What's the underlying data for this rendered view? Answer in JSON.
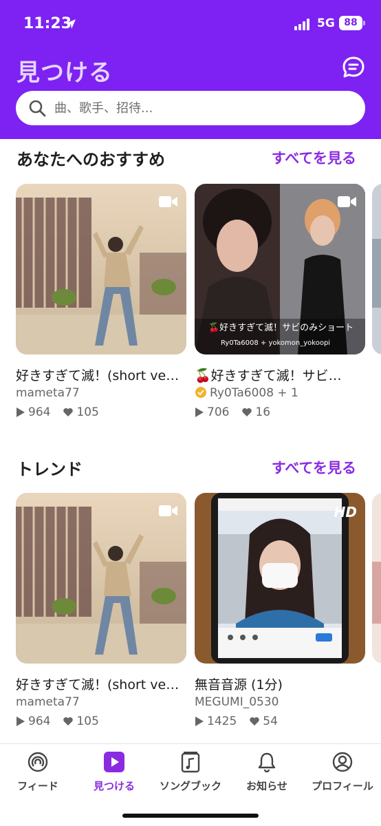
{
  "status": {
    "time": "11:23",
    "network": "5G",
    "battery": "88"
  },
  "header": {
    "title": "見つける"
  },
  "search": {
    "placeholder": "曲、歌手、招待..."
  },
  "sections": [
    {
      "title": "あなたへのおすすめ",
      "see_all": "すべてを見る",
      "cards": [
        {
          "title": "好きすぎて滅！(short ve…",
          "user": "mameta77",
          "plays": "964",
          "likes": "105",
          "badge": "video-icon"
        },
        {
          "title": "🍒好きすぎて滅！サビ…",
          "user": "Ry0Ta6008 + 1",
          "plays": "706",
          "likes": "16",
          "badge": "video-icon",
          "verified": true,
          "overlay_caption": "🍒好きすぎて滅！サビのみショート",
          "overlay_sub": "Ry0Ta6008 + yokomon_yokoopi"
        }
      ]
    },
    {
      "title": "トレンド",
      "see_all": "すべてを見る",
      "cards": [
        {
          "title": "好きすぎて滅！(short ve…",
          "user": "mameta77",
          "plays": "964",
          "likes": "105",
          "badge": "video-icon"
        },
        {
          "title": "無音音源 (1分)",
          "user": "MEGUMI_0530",
          "plays": "1425",
          "likes": "54",
          "badge": "HD"
        }
      ]
    }
  ],
  "nav": [
    {
      "label": "フィード",
      "icon": "feed-icon"
    },
    {
      "label": "見つける",
      "icon": "discover-icon",
      "active": true
    },
    {
      "label": "ソングブック",
      "icon": "songbook-icon"
    },
    {
      "label": "お知らせ",
      "icon": "bell-icon"
    },
    {
      "label": "プロフィール",
      "icon": "profile-icon"
    }
  ],
  "colors": {
    "brand": "#7d22f2",
    "accent": "#8a2be2"
  }
}
